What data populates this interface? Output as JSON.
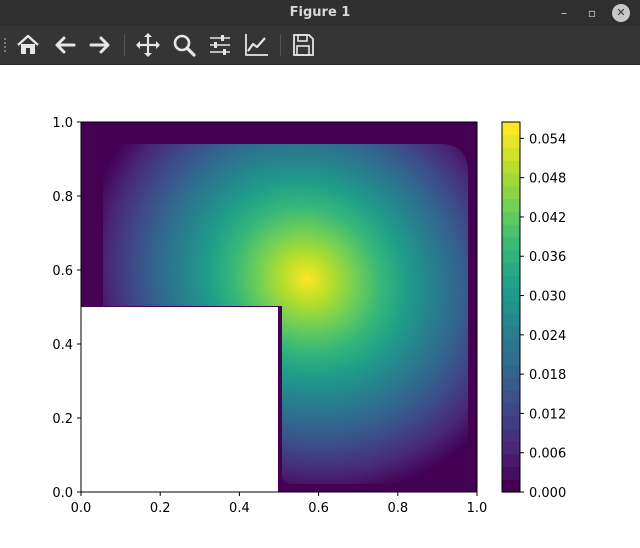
{
  "window": {
    "title": "Figure 1",
    "minimize_label": "–",
    "maximize_label": "▫",
    "close_label": "✕"
  },
  "toolbar": {
    "buttons": [
      {
        "icon": "home-icon",
        "tooltip": "Home"
      },
      {
        "icon": "back-arrow-icon",
        "tooltip": "Back"
      },
      {
        "icon": "forward-arrow-icon",
        "tooltip": "Forward"
      },
      {
        "icon": "pan-icon",
        "tooltip": "Pan"
      },
      {
        "icon": "zoom-icon",
        "tooltip": "Zoom"
      },
      {
        "icon": "configure-subplots-icon",
        "tooltip": "Configure subplots"
      },
      {
        "icon": "edit-axes-icon",
        "tooltip": "Edit axes"
      },
      {
        "icon": "save-icon",
        "tooltip": "Save"
      }
    ]
  },
  "chart_data": {
    "type": "heatmap",
    "subtype": "filled-contour",
    "colormap": "viridis",
    "xlim": [
      0.0,
      1.0
    ],
    "ylim": [
      0.0,
      1.0
    ],
    "x_ticks": [
      "0.0",
      "0.2",
      "0.4",
      "0.6",
      "0.8",
      "1.0"
    ],
    "y_ticks": [
      "0.0",
      "0.2",
      "0.4",
      "0.6",
      "0.8",
      "1.0"
    ],
    "colorbar": {
      "min": 0.0,
      "max": 0.0565,
      "ticks": [
        "0.000",
        "0.006",
        "0.012",
        "0.018",
        "0.024",
        "0.030",
        "0.036",
        "0.042",
        "0.048",
        "0.054"
      ],
      "levels": 29
    },
    "domain": "L-shaped region: unit square minus the lower-left quadrant [0,0.5]x[0,0.5]",
    "excluded_region": {
      "x": [
        0.0,
        0.5
      ],
      "y": [
        0.0,
        0.5
      ]
    },
    "peak": {
      "x": 0.57,
      "y": 0.58,
      "value": 0.056
    },
    "boundary_value": 0.0,
    "colors": [
      "#440154",
      "#482878",
      "#3e4989",
      "#31688e",
      "#26828e",
      "#1f9e89",
      "#35b779",
      "#6ece58",
      "#b5de2b",
      "#fde725"
    ]
  }
}
